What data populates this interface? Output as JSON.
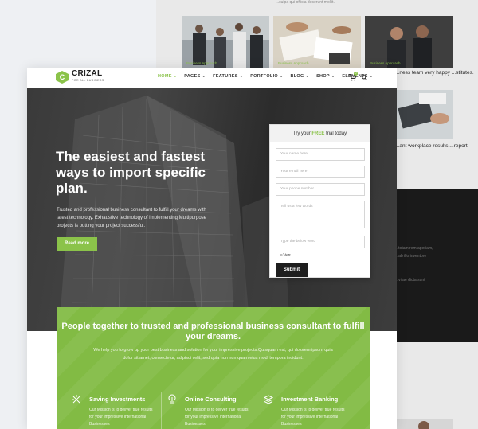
{
  "back_page": {
    "top_text": "...culpa qui officia deserunt mollit.",
    "card_captions": [
      "Business Approach",
      "Business Approach",
      "Business Approach"
    ],
    "dark_caption_1": "...ness team very happy ...stitutes.",
    "dark_caption_2": "...ant workplace results ...report.",
    "dark_text_1": "...totam rem aperiam,",
    "dark_text_2": "...ab illo inventore",
    "dark_text_3": "...vitae dicta sunt"
  },
  "nav": {
    "logo_letter": "C",
    "logo_name": "CRIZAL",
    "logo_tagline": "FOR ALL BUSINESS",
    "menu": [
      {
        "label": "HOME",
        "active": true
      },
      {
        "label": "PAGES"
      },
      {
        "label": "FEATURES"
      },
      {
        "label": "PORTFOLIO"
      },
      {
        "label": "BLOG"
      },
      {
        "label": "SHOP"
      },
      {
        "label": "ELEMENTS"
      }
    ],
    "cart_icon": "cart-icon",
    "cart_count": "0",
    "search_icon": "search-icon"
  },
  "hero": {
    "title": "The easiest and fastest ways to import specific plan.",
    "description": "Trusted and professional business consultant to fulfill your dreams with latest technology. Exhaustive technology of implementing Multipurpose projects is putting your project successful.",
    "button": "Read more"
  },
  "form": {
    "heading_prefix": "Try your",
    "heading_highlight": "FREE",
    "heading_suffix": "trial today",
    "name_placeholder": "Your name here",
    "email_placeholder": "Your email here",
    "phone_placeholder": "Your phone number",
    "message_placeholder": "Tell us a few words",
    "captcha_input_placeholder": "Type the below word",
    "captcha_word": "cAtcn",
    "submit": "Submit"
  },
  "band": {
    "title": "People together to trusted and professional business consultant to fulfill your dreams.",
    "description": "We help you to grow up your best business and solution for your impressive projects.Quisquam est, qui dolorem ipsum quia dolor sit amet, consectetur, adipisci velit, sed quia non numquam eius modi tempora incidunt.",
    "features": [
      {
        "title": "Saving Investments",
        "icon": "compass-icon",
        "text": "Our Mission is to deliver true results for your impressive International Businesses"
      },
      {
        "title": "Online Consulting",
        "icon": "lightbulb-icon",
        "text": "Our Mission is to deliver true results for your impressive International Businesses"
      },
      {
        "title": "Investment Banking",
        "icon": "stack-icon",
        "text": "Our Mission is to deliver true results for your impressive International Businesses"
      }
    ]
  },
  "colors": {
    "accent": "#8bc34a",
    "dark": "#1e1e1e",
    "band": "#82bb44"
  }
}
